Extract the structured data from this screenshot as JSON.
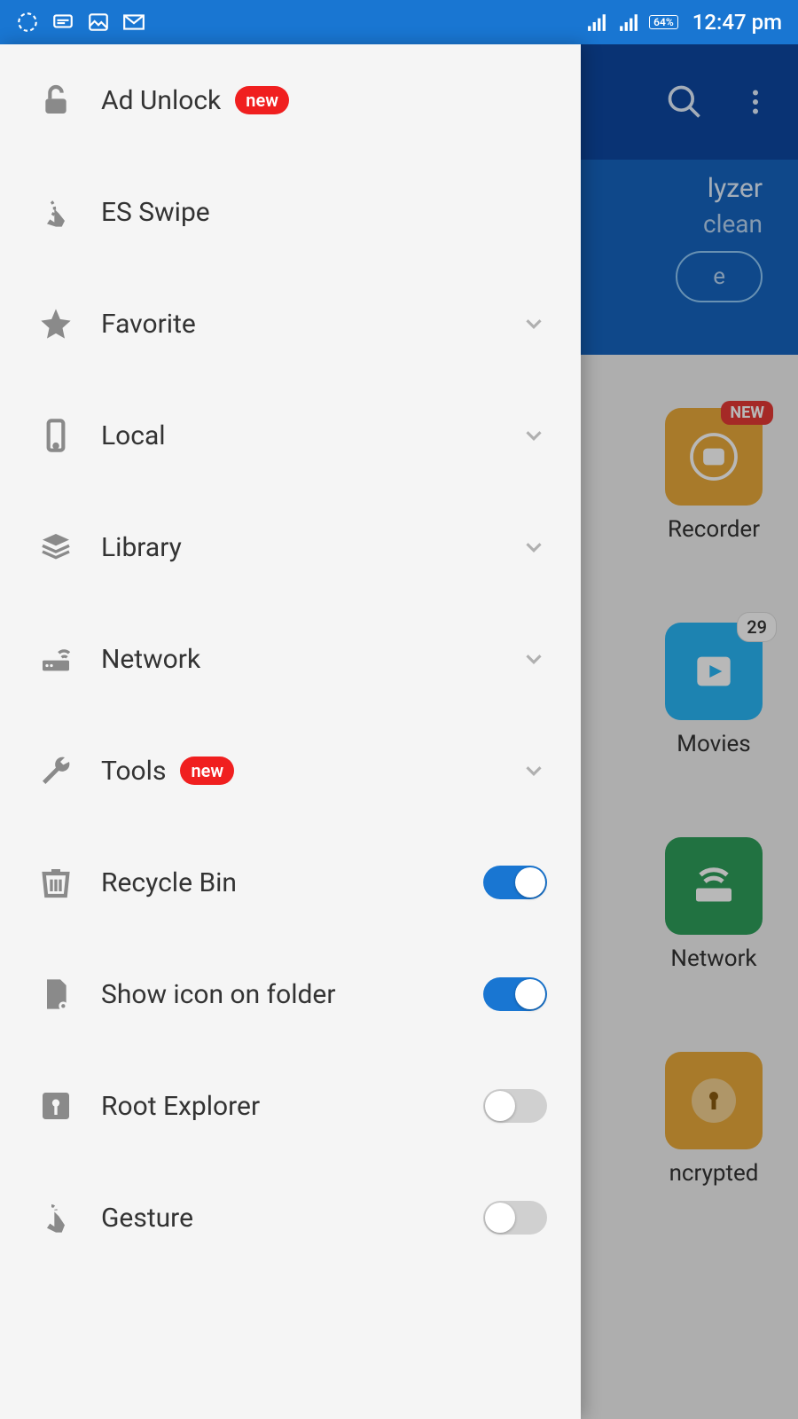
{
  "status": {
    "battery": "64%",
    "clock": "12:47 pm"
  },
  "drawer": {
    "items": [
      {
        "label": "Ad Unlock",
        "badge_new": "new"
      },
      {
        "label": "ES Swipe"
      },
      {
        "label": "Favorite"
      },
      {
        "label": "Local"
      },
      {
        "label": "Library"
      },
      {
        "label": "Network"
      },
      {
        "label": "Tools",
        "badge_new": "new"
      },
      {
        "label": "Recycle Bin",
        "toggle": true
      },
      {
        "label": "Show icon on folder",
        "toggle": true
      },
      {
        "label": "Root Explorer",
        "toggle": false
      },
      {
        "label": "Gesture",
        "toggle": false
      }
    ]
  },
  "background": {
    "analyzer": {
      "title_fragment": "lyzer",
      "subtitle_fragment": "clean",
      "pill_fragment": "e"
    },
    "grid": [
      {
        "label": "Recorder",
        "badge_new": "NEW",
        "tile_color": "#e9a93b"
      },
      {
        "label": "Movies",
        "badge_count": "29",
        "tile_color": "#29b6f6"
      },
      {
        "label": "Network",
        "tile_color": "#2e9e5b"
      },
      {
        "label": "ncrypted",
        "tile_color": "#e9a93b"
      }
    ]
  }
}
